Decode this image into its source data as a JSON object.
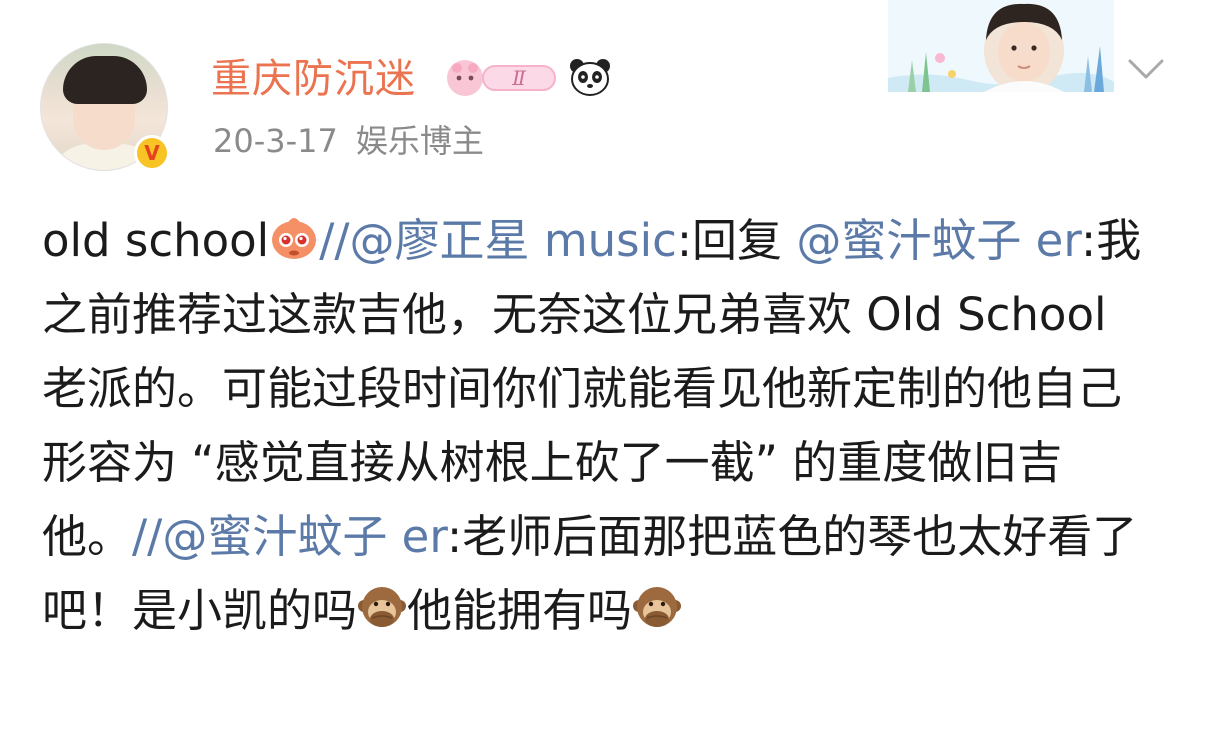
{
  "post": {
    "username": "重庆防沉迷",
    "date": "20-3-17",
    "tag": "娱乐博主",
    "level_badge_text": "Ⅱ",
    "verified_badge": "V"
  },
  "icons": {
    "verified": "verified-v-icon",
    "level": "fan-level-badge-icon",
    "panda": "panda-icon",
    "chevron": "chevron-down-icon",
    "emoji_sparkle": "cute-sparkle-emoji",
    "emoji_monkey": "see-no-evil-monkey-emoji"
  },
  "colors": {
    "username": "#eb7350",
    "mention": "#5b7aa8",
    "meta": "#8a8a8a",
    "text": "#1b1b1b"
  },
  "content": {
    "p1": "old school",
    "sep1": "//",
    "mention1": "@廖正星 music",
    "p2": ":回复 ",
    "mention2": "@蜜汁蚊子 er",
    "p3": ":我之前推荐过这款吉他，无奈这位兄弟喜欢 Old School 老派的。可能过段时间你们就能看见他新定制的他自己形容为 “感觉直接从树根上砍了一截” 的重度做旧吉他。",
    "sep2": "//",
    "mention3": "@蜜汁蚊子 er",
    "p4": ":老师后面那把蓝色的琴也太好看了吧！是小凯的吗",
    "p5": "他能拥有吗"
  }
}
